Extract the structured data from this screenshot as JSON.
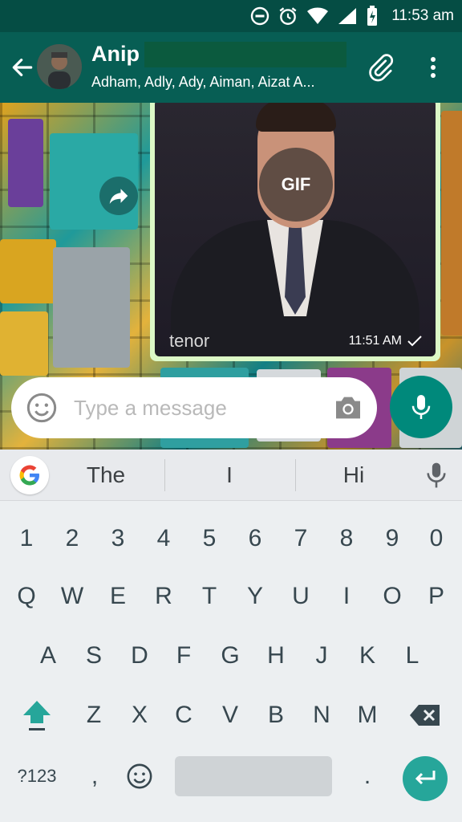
{
  "status_bar": {
    "time": "11:53 am",
    "icons": [
      "do-not-disturb-icon",
      "alarm-icon",
      "wifi-icon",
      "signal-icon",
      "battery-charging-icon"
    ]
  },
  "header": {
    "title": "Anip",
    "subtitle": "Adham, Adly, Ady, Aiman, Aizat A...",
    "icons": [
      "back-arrow-icon",
      "avatar",
      "paperclip-icon",
      "more-vert-icon"
    ]
  },
  "message": {
    "gif_badge": "GIF",
    "provider": "tenor",
    "time": "11:51 AM",
    "status_icon": "check-icon"
  },
  "composer": {
    "placeholder": "Type a message"
  },
  "suggestions": [
    "The",
    "I",
    "Hi"
  ],
  "keyboard": {
    "row_numbers": [
      "1",
      "2",
      "3",
      "4",
      "5",
      "6",
      "7",
      "8",
      "9",
      "0"
    ],
    "row1": [
      "Q",
      "W",
      "E",
      "R",
      "T",
      "Y",
      "U",
      "I",
      "O",
      "P"
    ],
    "row2": [
      "A",
      "S",
      "D",
      "F",
      "G",
      "H",
      "J",
      "K",
      "L"
    ],
    "row3": [
      "Z",
      "X",
      "C",
      "V",
      "B",
      "N",
      "M"
    ],
    "symbols_key": "?123",
    "comma": ",",
    "period": "."
  },
  "colors": {
    "status_bar": "#054d44",
    "app_bar": "#075e54",
    "bubble": "#dcf8c6",
    "mic_button": "#00897b",
    "enter_key": "#26a69a",
    "shift_arrow": "#26a69a"
  }
}
